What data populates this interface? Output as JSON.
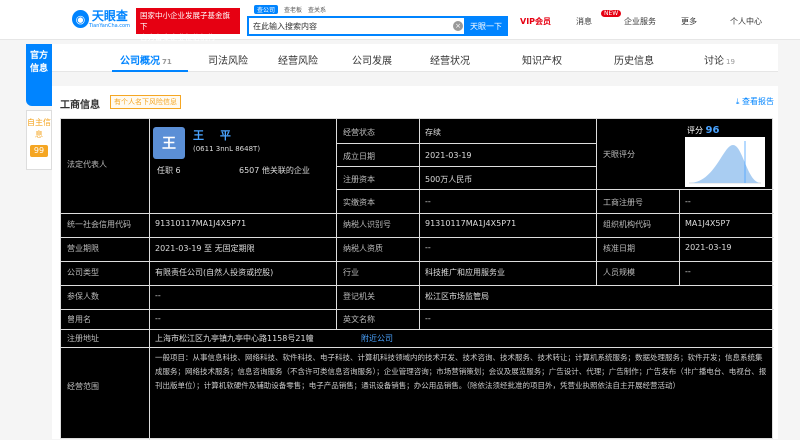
{
  "header": {
    "logo_text": "天眼查",
    "logo_sub": "TianYanCha.com",
    "promo_lines": [
      "国家中小企业发展子基金旗下",
      "官方备案企业征信机构"
    ],
    "search_tabs": [
      "查公司",
      "查老板",
      "查关系"
    ],
    "search_value": "在此输入搜索内容",
    "search_button": "天眼一下",
    "nav": [
      "VIP会员",
      "消息",
      "企业服务",
      "更多",
      "个人中心"
    ],
    "new_badge": "NEW"
  },
  "side": {
    "primary": "官方信息",
    "secondary": "自主信息",
    "secondary_badge": "99"
  },
  "tabs": [
    {
      "label": "公司概况",
      "count": "71",
      "active": true
    },
    {
      "label": "司法风险",
      "count": "",
      "active": false
    },
    {
      "label": "经营风险",
      "count": "",
      "active": false
    },
    {
      "label": "公司发展",
      "count": "",
      "active": false
    },
    {
      "label": "经营状况",
      "count": "",
      "active": false
    },
    {
      "label": "知识产权",
      "count": "",
      "active": false
    },
    {
      "label": "历史信息",
      "count": "",
      "active": false
    },
    {
      "label": "讨论",
      "count": "19",
      "active": false
    }
  ],
  "section": {
    "title": "工商信息",
    "tag": "有个人名下风险信息",
    "report_link": "查看报告"
  },
  "business_info": {
    "legal_rep_label": "法定代表人",
    "person_initial": "王",
    "person_name": "王 平",
    "person_sub": "(0611 3nnL 8648T)",
    "person_holding": "任职 6",
    "person_more": "6507 他关联的企业",
    "rows": [
      {
        "label": "经营状态",
        "value": "存续"
      },
      {
        "label": "成立日期",
        "value": "2021-03-19"
      },
      {
        "label": "注册资本",
        "value": "500万人民币"
      },
      {
        "label": "实缴资本",
        "value": "--"
      },
      {
        "label": "工商注册号",
        "value": "--"
      },
      {
        "label": "天眼评分",
        "value": "96"
      },
      {
        "label": "统一社会信用代码",
        "value": "91310117MA1J4X5P71"
      },
      {
        "label": "纳税人识别号",
        "value": "91310117MA1J4X5P71"
      },
      {
        "label": "组织机构代码",
        "value": "MA1J4X5P7"
      },
      {
        "label": "营业期限",
        "value": "2021-03-19 至 无固定期限"
      },
      {
        "label": "纳税人资质",
        "value": "--"
      },
      {
        "label": "核准日期",
        "value": "2021-03-19"
      },
      {
        "label": "公司类型",
        "value": "有限责任公司(自然人投资或控股)"
      },
      {
        "label": "行业",
        "value": "科技推广和应用服务业"
      },
      {
        "label": "人员规模",
        "value": "--"
      },
      {
        "label": "参保人数",
        "value": "--"
      },
      {
        "label": "登记机关",
        "value": "松江区市场监管局"
      },
      {
        "label": "曾用名",
        "value": "--"
      },
      {
        "label": "英文名称",
        "value": "--"
      },
      {
        "label": "注册地址",
        "value": "上海市松江区九亭镇九亭中心路1158号21幢",
        "link": "附近公司"
      },
      {
        "label": "经营范围",
        "value": "一般项目：从事信息科技、网络科技、软件科技、电子科技、计算机科技领域内的技术开发、技术咨询、技术服务、技术转让；计算机系统服务；数据处理服务；软件开发；信息系统集成服务；网络技术服务；信息咨询服务（不含许可类信息咨询服务）；企业管理咨询；市场营销策划；会议及展览服务；广告设计、代理；广告制作；广告发布（非广播电台、电视台、报刊出版单位）；计算机软硬件及辅助设备零售；电子产品销售；通讯设备销售；办公用品销售。（除依法须经批准的项目外，凭营业执照依法自主开展经营活动）"
      }
    ],
    "score_label": "评分",
    "score_value": "96"
  }
}
